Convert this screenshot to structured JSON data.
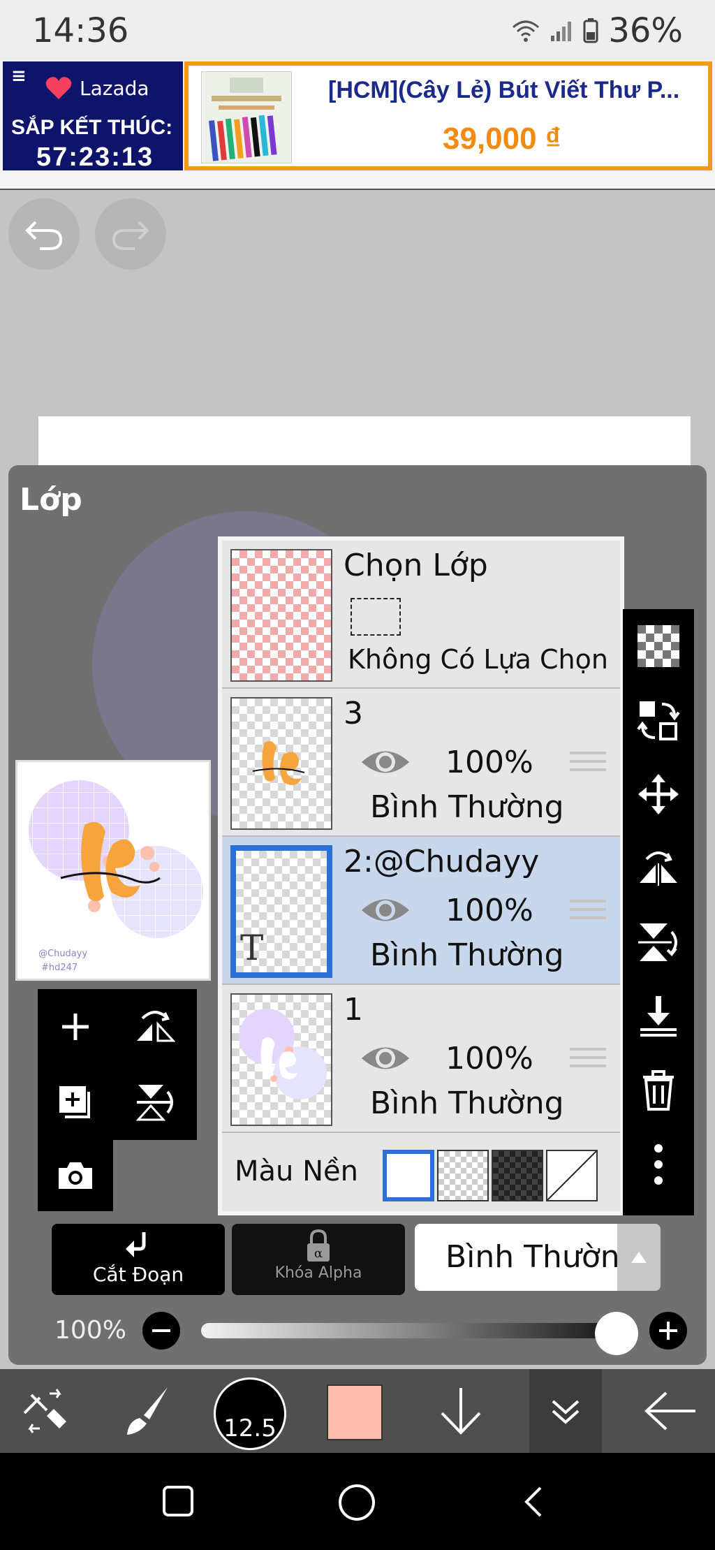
{
  "status_bar": {
    "time": "14:36",
    "battery": "36%"
  },
  "ad": {
    "brand": "Lazada",
    "cta": "SẮP KẾT THÚC:",
    "timer": "57:23:13",
    "product": "[HCM](Cây Lẻ) Bút Viết Thư P...",
    "price": "39,000 ₫"
  },
  "panel": {
    "title": "Lớp"
  },
  "layers": {
    "selection": {
      "title": "Chọn Lớp",
      "status": "Không Có Lựa Chọn"
    },
    "items": [
      {
        "name": "3",
        "opacity": "100%",
        "blend": "Bình Thường"
      },
      {
        "name": "2:@Chudayy",
        "opacity": "100%",
        "blend": "Bình Thường",
        "selected": true,
        "type_icon": "T"
      },
      {
        "name": "1",
        "opacity": "100%",
        "blend": "Bình Thường"
      }
    ],
    "background": {
      "label": "Màu Nền"
    }
  },
  "controls": {
    "clip_label": "Cắt Đoạn",
    "alpha_label": "Khóa Alpha",
    "blend_mode": "Bình Thường",
    "opacity_label": "100%",
    "opacity_value": 1.0
  },
  "toolbar": {
    "brush_size": "12.5",
    "current_color": "#ffbcaa"
  },
  "preview": {
    "handle": "@Chudayy",
    "tag": "#hd247"
  },
  "colors": {
    "selected_row": "#c8d7ec",
    "accent": "#2c6fd6",
    "ad_price": "#f28a13"
  }
}
